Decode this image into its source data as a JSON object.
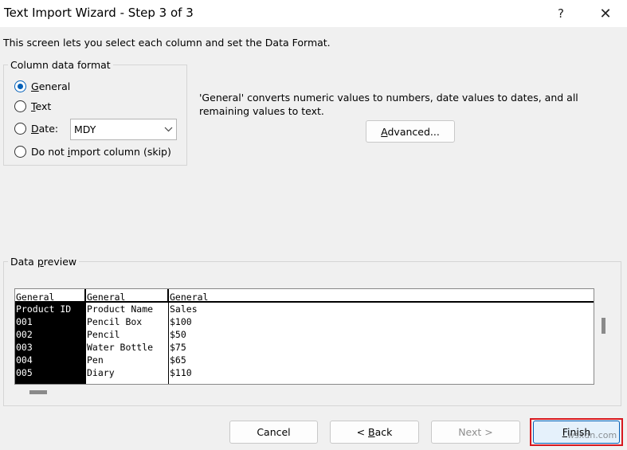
{
  "window": {
    "title": "Text Import Wizard - Step 3 of 3",
    "help_glyph": "?",
    "close_glyph": "✕"
  },
  "description": "This screen lets you select each column and set the Data Format.",
  "column_format": {
    "label": "Column data format",
    "options": {
      "general": {
        "mnemonic": "G",
        "rest": "eneral",
        "checked": true
      },
      "text": {
        "mnemonic": "T",
        "rest": "ext",
        "checked": false
      },
      "date": {
        "mnemonic": "D",
        "rest": "ate:",
        "checked": false
      },
      "skip": {
        "pre": "Do not ",
        "mnemonic": "i",
        "rest": "mport column (skip)",
        "checked": false
      }
    },
    "date_select": {
      "value": "MDY",
      "arrow_icon": "chevron-down-icon"
    }
  },
  "info_text": "'General' converts numeric values to numbers, date values to dates, and all remaining values to text.",
  "advanced_button": {
    "mnemonic": "A",
    "rest": "dvanced..."
  },
  "preview": {
    "label_pre": "Data ",
    "label_mnemonic": "p",
    "label_rest": "review",
    "columns": [
      {
        "header": "General",
        "cells": [
          "Product ID",
          "001",
          "002",
          "003",
          "004",
          "005"
        ],
        "selected": true
      },
      {
        "header": "General",
        "cells": [
          "Product Name",
          "Pencil Box",
          "Pencil",
          "Water Bottle",
          "Pen",
          "Diary"
        ],
        "selected": false
      },
      {
        "header": "General",
        "cells": [
          "Sales",
          "$100",
          "$50",
          "$75",
          "$65",
          "$110"
        ],
        "selected": false
      }
    ]
  },
  "buttons": {
    "cancel": "Cancel",
    "back": {
      "pre": "< ",
      "mnemonic": "B",
      "rest": "ack"
    },
    "next": {
      "pre": "Next >",
      "enabled": false
    },
    "finish": {
      "mnemonic": "F",
      "rest": "inish",
      "highlight_color": "#d7181f"
    }
  },
  "watermark": "wsxdn.com",
  "colors": {
    "accent": "#005fb8",
    "background": "#f0f0f0"
  }
}
